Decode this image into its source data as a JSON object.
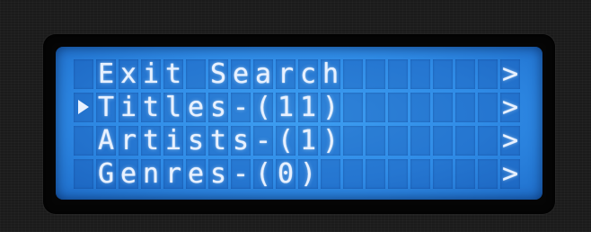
{
  "display": {
    "rows": [
      "Exit Search",
      "Titles-(11)",
      "Artists-(1)",
      "Genres-(0)"
    ],
    "row_suffix": ">",
    "selected_row": 1
  },
  "colors": {
    "backlight": "#2f8be6",
    "pixel_on": "#e8f1ff",
    "bezel": "#1b1b1b"
  }
}
